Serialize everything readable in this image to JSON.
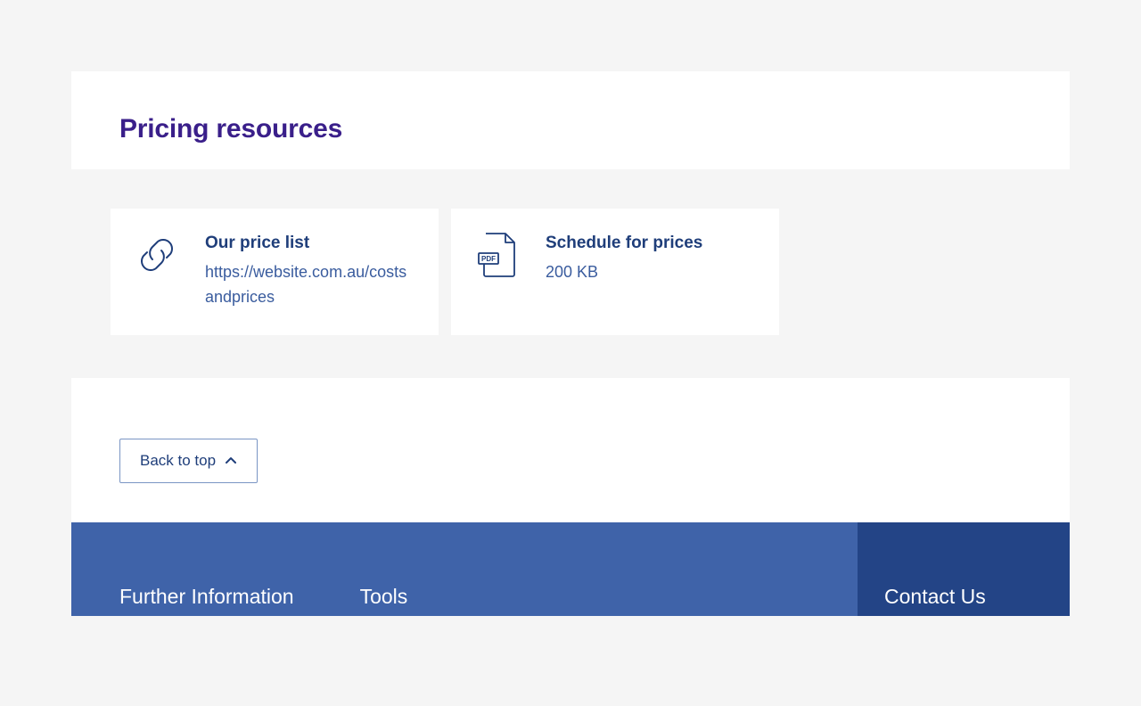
{
  "section": {
    "title": "Pricing resources"
  },
  "cards": [
    {
      "title": "Our price list",
      "subtitle": "https://website.com.au/costsandprices"
    },
    {
      "title": "Schedule for prices",
      "subtitle": "200 KB"
    }
  ],
  "back_to_top": {
    "label": "Back to top"
  },
  "footer": {
    "col1": "Further Information",
    "col2": "Tools",
    "contact": "Contact Us"
  }
}
